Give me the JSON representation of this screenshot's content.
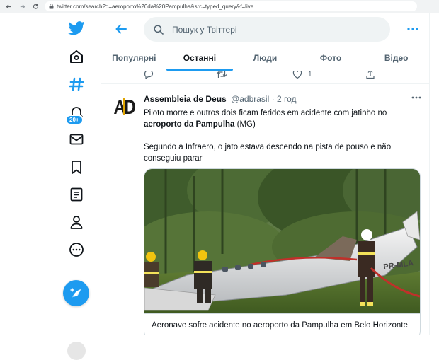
{
  "browser": {
    "url": "twitter.com/search?q=aeroporto%20da%20Pampulha&src=typed_query&f=live"
  },
  "sidebar": {
    "notification_count": "20+"
  },
  "search": {
    "placeholder": "Пошук у Твіттері"
  },
  "tabs": [
    {
      "label": "Популярні",
      "active": false
    },
    {
      "label": "Останні",
      "active": true
    },
    {
      "label": "Люди",
      "active": false
    },
    {
      "label": "Фото",
      "active": false
    },
    {
      "label": "Відео",
      "active": false
    }
  ],
  "previous_tweet": {
    "like_count": "1"
  },
  "tweet": {
    "author_name": "Assembleia de Deus",
    "author_handle": "@adbrasil",
    "separator": " · ",
    "time": "2 год",
    "text_line1": "Piloto morre e outros dois ficam feridos em acidente com jatinho no",
    "text_bold": "aeroporto da Pampulha",
    "text_after_bold": " (MG)",
    "text_para2": "Segundo a Infraero, o jato estava descendo na pista de pouso e não conseguiu parar",
    "image_plane_registration": "PR-MLA",
    "card_caption": "Aeronave sofre acidente no aeroporto da Pampulha em Belo Horizonte"
  },
  "colors": {
    "accent": "#1d9bf0",
    "text": "#0f1419",
    "secondary_text": "#536471"
  },
  "icons": [
    "twitter-logo-icon",
    "home-icon",
    "hashtag-icon",
    "bell-icon",
    "mail-icon",
    "bookmark-icon",
    "list-icon",
    "profile-icon",
    "more-circle-icon",
    "compose-icon",
    "back-arrow-icon",
    "search-icon",
    "more-dots-icon"
  ]
}
